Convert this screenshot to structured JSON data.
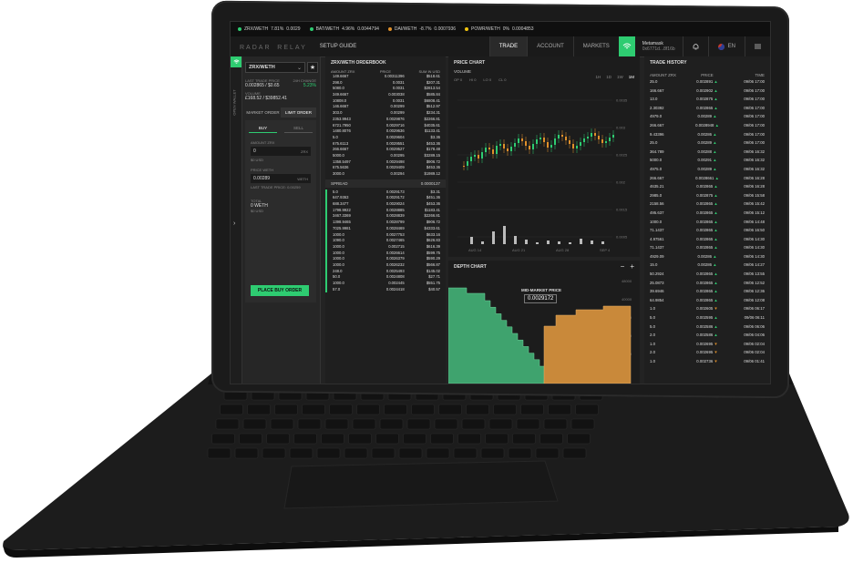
{
  "ticker": [
    {
      "pair": "ZRX/WETH",
      "change": "7.81%",
      "price": "0.0029",
      "color": "#2ecc71"
    },
    {
      "pair": "BAT/WETH",
      "change": "4.96%",
      "price": "0.0044794",
      "color": "#2ecc71"
    },
    {
      "pair": "DAI/WETH",
      "change": "-8.7%",
      "price": "0.0007936",
      "color": "#e0902a"
    },
    {
      "pair": "POWR/WETH",
      "change": "0%",
      "price": "0.0004853",
      "color": "#f1c40f"
    }
  ],
  "nav": {
    "logo": "RADAR",
    "logo_sub": "RELAY",
    "setup": "SETUP GUIDE",
    "tabs": [
      "TRADE",
      "ACCOUNT",
      "MARKETS"
    ],
    "wallet_label": "Metamask",
    "wallet_addr": "0x6771d...8f16b",
    "lang": "EN"
  },
  "left": {
    "side_label": "OPEN WALLET",
    "pair": "ZRX/WETH",
    "last_price_label": "LAST TRADE PRICE",
    "last_price": "0.002865 / $0.65",
    "change_label": "24H CHANGE",
    "change": "5.23%",
    "volume_label": "VOLUME",
    "volume": "£168.52 / $39852.41",
    "tab_market": "MARKET ORDER",
    "tab_limit": "LIMIT ORDER",
    "buy": "BUY",
    "sell": "SELL",
    "amount_label": "AMOUNT ZRX",
    "amount": "0",
    "amount_unit": "ZRX",
    "amount_usd": "$0 USD",
    "price_label": "PRICE WETH",
    "price": "0.00289",
    "price_unit": "WETH",
    "last_trade": "LAST TRADE PRICE: 0.00259",
    "total_label": "TOTAL",
    "total": "0 WETH",
    "total_usd": "$0 USD",
    "place_btn": "PLACE BUY ORDER"
  },
  "orderbook": {
    "title": "ZRX/WETH ORDERBOOK",
    "headers": [
      "AMOUNT ZRX",
      "PRICE",
      "SUM IN USD"
    ],
    "asks": [
      [
        "149.6667",
        "0.00311396",
        "$518.61"
      ],
      [
        "298.0",
        "0.0031",
        "$207.31"
      ],
      [
        "5080.0",
        "0.0031",
        "$2813.54"
      ],
      [
        "349.6667",
        "0.003038",
        "$585.84"
      ],
      [
        "10808.0",
        "0.0031",
        "$6808.41"
      ],
      [
        "146.6667",
        "0.00299",
        "$512.97"
      ],
      [
        "303.0",
        "0.00299",
        "$234.31"
      ],
      [
        "2353.9943",
        "0.0029876",
        "$2266.81"
      ],
      [
        "6721.7950",
        "0.0029716",
        "$4035.61"
      ],
      [
        "1480.8076",
        "0.0029636",
        "$1133.41"
      ],
      [
        "5.0",
        "0.0029604",
        "$3.36"
      ],
      [
        "675.6113",
        "0.0029551",
        "$453.36"
      ],
      [
        "266.6667",
        "0.0029527",
        "$178.48"
      ],
      [
        "5000.0",
        "0.00295",
        "$3289.15"
      ],
      [
        "1358.5497",
        "0.0029498",
        "$906.72"
      ],
      [
        "675.5636",
        "0.0029409",
        "$453.36"
      ],
      [
        "3000.0",
        "0.00294",
        "$1989.12"
      ]
    ],
    "spread_label": "SPREAD",
    "spread": "0.0000137",
    "bids": [
      [
        "5.0",
        "0.0029173",
        "$3.31"
      ],
      [
        "647.9363",
        "0.0029172",
        "$451.36"
      ],
      [
        "688.3477",
        "0.0029024",
        "$453.36"
      ],
      [
        "1798.9922",
        "0.0028885",
        "$1183.41"
      ],
      [
        "3467.3369",
        "0.0028839",
        "$2266.81"
      ],
      [
        "1398.9465",
        "0.0028799",
        "$906.72"
      ],
      [
        "7025.9981",
        "0.0028469",
        "$4333.61"
      ],
      [
        "1000.0",
        "0.0027753",
        "$633.16"
      ],
      [
        "1090.0",
        "0.0027465",
        "$626.83"
      ],
      [
        "1000.0",
        "0.002715",
        "$616.39"
      ],
      [
        "1000.0",
        "0.0026614",
        "$599.75"
      ],
      [
        "1000.0",
        "0.0026379",
        "$590.29"
      ],
      [
        "1000.0",
        "0.0026232",
        "$566.87"
      ],
      [
        "248.0",
        "0.0025493",
        "$145.02"
      ],
      [
        "50.0",
        "0.0024808",
        "$27.71"
      ],
      [
        "1000.0",
        "0.002445",
        "$551.75"
      ],
      [
        "57.0",
        "0.0024418",
        "$40.57"
      ]
    ]
  },
  "pricechart": {
    "title": "PRICE CHART",
    "volume": "VOLUME",
    "ohlc": [
      {
        "k": "OP",
        "v": "0"
      },
      {
        "k": "HI",
        "v": "0"
      },
      {
        "k": "LO",
        "v": "0"
      },
      {
        "k": "CL",
        "v": "0"
      }
    ],
    "ranges": [
      "1H",
      "1D",
      "1W",
      "1M"
    ],
    "yticks": [
      "0.0035",
      "0.003",
      "0.0025",
      "0.002",
      "0.0015",
      "0.0005"
    ],
    "xticks": [
      "AUG 14",
      "AUG 21",
      "AUG 28",
      "SEP 4"
    ]
  },
  "depth": {
    "title": "DEPTH CHART",
    "mid_label": "MID-MARKET PRICE",
    "mid": "0.0029172",
    "yticks": [
      "48000",
      "40000",
      "32000",
      "24000",
      "16000",
      "8000"
    ]
  },
  "history": {
    "title": "TRADE HISTORY",
    "headers": [
      "AMOUNT ZRX",
      "PRICE",
      "TIME"
    ],
    "rows": [
      [
        "25.0",
        "0.002891",
        "up",
        "09/06 17:00"
      ],
      [
        "166.667",
        "0.002902",
        "up",
        "09/06 17:00"
      ],
      [
        "13.0",
        "0.002875",
        "up",
        "09/06 17:00"
      ],
      [
        "2.30392",
        "0.002865",
        "up",
        "09/06 17:00"
      ],
      [
        "4979.0",
        "0.00289",
        "up",
        "09/06 17:00"
      ],
      [
        "266.667",
        "0.0028948",
        "up",
        "09/06 17:00"
      ],
      [
        "9.43396",
        "0.00286",
        "up",
        "09/06 17:00"
      ],
      [
        "25.0",
        "0.00289",
        "up",
        "09/06 17:00"
      ],
      [
        "364.789",
        "0.00288",
        "up",
        "09/06 16:32"
      ],
      [
        "5000.0",
        "0.00291",
        "up",
        "09/06 16:32"
      ],
      [
        "4975.0",
        "0.00289",
        "up",
        "09/06 16:32"
      ],
      [
        "266.667",
        "0.0028661",
        "up",
        "09/06 16:28"
      ],
      [
        "4635.21",
        "0.002865",
        "up",
        "09/06 16:28"
      ],
      [
        "2985.0",
        "0.002875",
        "up",
        "09/06 15:58"
      ],
      [
        "2158.56",
        "0.002865",
        "up",
        "09/06 15:42"
      ],
      [
        "495.637",
        "0.002865",
        "up",
        "09/06 15:12"
      ],
      [
        "1000.0",
        "0.002865",
        "up",
        "09/06 14:48"
      ],
      [
        "71.1437",
        "0.002865",
        "up",
        "09/06 16:50"
      ],
      [
        "4.97561",
        "0.002865",
        "up",
        "09/06 14:30"
      ],
      [
        "71.1437",
        "0.002865",
        "up",
        "09/06 14:30"
      ],
      [
        "4929.09",
        "0.00286",
        "up",
        "09/06 14:30"
      ],
      [
        "15.0",
        "0.00286",
        "up",
        "09/06 14:27"
      ],
      [
        "50.2924",
        "0.002865",
        "up",
        "09/06 13:55"
      ],
      [
        "25.0873",
        "0.002865",
        "up",
        "09/06 12:52"
      ],
      [
        "39.6946",
        "0.002865",
        "up",
        "09/06 12:36"
      ],
      [
        "64.9854",
        "0.002865",
        "up",
        "09/06 12:08"
      ],
      [
        "1.0",
        "0.002605",
        "down",
        "09/06 06:17"
      ],
      [
        "5.0",
        "0.002595",
        "up",
        "09/06 06:11"
      ],
      [
        "5.0",
        "0.002586",
        "up",
        "09/06 06:06"
      ],
      [
        "2.0",
        "0.002586",
        "up",
        "09/06 04:06"
      ],
      [
        "1.0",
        "0.002695",
        "down",
        "09/06 02:04"
      ],
      [
        "2.0",
        "0.002695",
        "down",
        "09/06 02:04"
      ],
      [
        "1.0",
        "0.002736",
        "down",
        "09/06 01:41"
      ]
    ]
  }
}
